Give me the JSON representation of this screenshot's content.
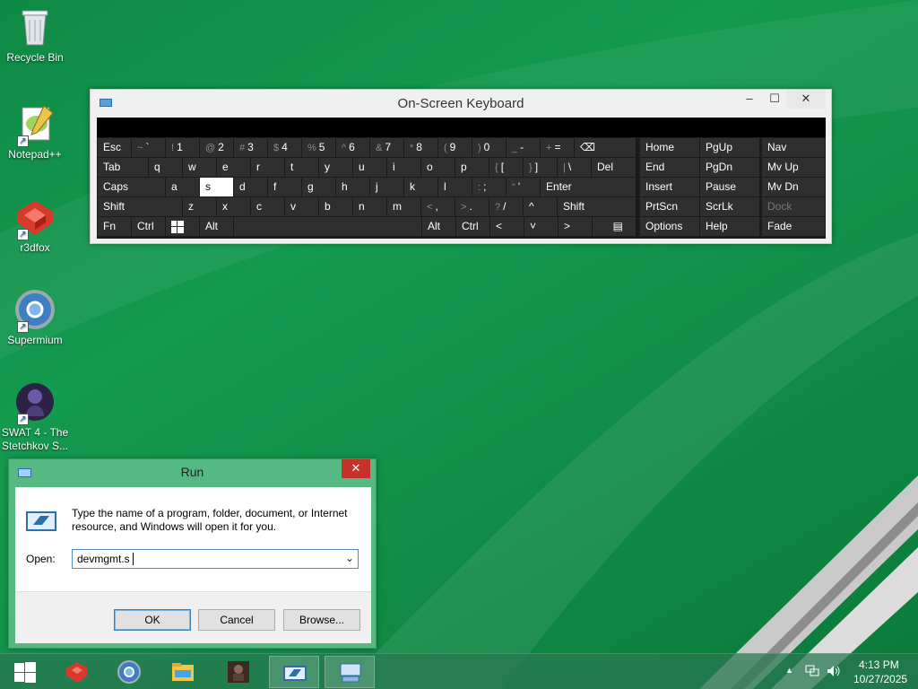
{
  "desktop": {
    "icons": [
      {
        "label": "Recycle Bin",
        "icon": "recycle-bin-icon"
      },
      {
        "label": "Notepad++",
        "icon": "notepad-plus-plus-icon"
      },
      {
        "label": "r3dfox",
        "icon": "r3dfox-icon"
      },
      {
        "label": "Supermium",
        "icon": "supermium-icon"
      },
      {
        "label": "SWAT 4 - The Stetchkov S...",
        "icon": "swat4-icon"
      }
    ]
  },
  "osk": {
    "title": "On-Screen Keyboard",
    "minimize": "–",
    "maximize": "☐",
    "close": "✕",
    "keys": {
      "esc": "Esc",
      "tilde_sh": "~",
      "tilde": "`",
      "k1_sh": "!",
      "k1": "1",
      "k2_sh": "@",
      "k2": "2",
      "k3_sh": "#",
      "k3": "3",
      "k4_sh": "$",
      "k4": "4",
      "k5_sh": "%",
      "k5": "5",
      "k6_sh": "^",
      "k6": "6",
      "k7_sh": "&",
      "k7": "7",
      "k8_sh": "*",
      "k8": "8",
      "k9_sh": "(",
      "k9": "9",
      "k0_sh": ")",
      "k0": "0",
      "minus_sh": "_",
      "minus": "-",
      "eq_sh": "+",
      "eq": "=",
      "backspace": "⌫",
      "tab": "Tab",
      "q": "q",
      "w": "w",
      "e": "e",
      "r": "r",
      "t": "t",
      "y": "y",
      "u": "u",
      "i": "i",
      "o": "o",
      "p": "p",
      "lbr_sh": "{",
      "lbr": "[",
      "rbr_sh": "}",
      "rbr": "]",
      "bsl_sh": "|",
      "bsl": "\\",
      "del": "Del",
      "caps": "Caps",
      "a": "a",
      "s": "s",
      "d": "d",
      "f": "f",
      "g": "g",
      "h": "h",
      "j": "j",
      "k": "k",
      "l": "l",
      "semi_sh": ":",
      "semi": ";",
      "quote_sh": "\"",
      "quote": "'",
      "enter": "Enter",
      "shift": "Shift",
      "z": "z",
      "x": "x",
      "c": "c",
      "v": "v",
      "b": "b",
      "n": "n",
      "m": "m",
      "comma_sh": "<",
      "comma": ",",
      "period_sh": ">",
      "period": ".",
      "slash_sh": "?",
      "slash": "/",
      "up": "^",
      "rshift": "Shift",
      "fn": "Fn",
      "ctrl": "Ctrl",
      "alt": "Alt",
      "ralt": "Alt",
      "rctrl": "Ctrl",
      "left": "<",
      "down": "˅",
      "right": ">",
      "menu": "▤",
      "home": "Home",
      "pgup": "PgUp",
      "nav": "Nav",
      "end": "End",
      "pgdn": "PgDn",
      "mvup": "Mv Up",
      "insert": "Insert",
      "pause": "Pause",
      "mvdn": "Mv Dn",
      "prtscn": "PrtScn",
      "scrlk": "ScrLk",
      "dock": "Dock",
      "options": "Options",
      "help": "Help",
      "fade": "Fade"
    }
  },
  "run": {
    "title": "Run",
    "close": "✕",
    "description": "Type the name of a program, folder, document, or Internet resource, and Windows will open it for you.",
    "open_label": "Open:",
    "open_value": "devmgmt.s",
    "ok": "OK",
    "cancel": "Cancel",
    "browse": "Browse..."
  },
  "taskbar": {
    "items": [
      "windows-start-icon",
      "r3dfox-icon",
      "supermium-icon",
      "file-explorer-icon",
      "swat4-icon",
      "run-icon",
      "on-screen-keyboard-icon"
    ],
    "time": "4:13 PM",
    "date": "10/27/2025",
    "tray_up": "▲"
  }
}
